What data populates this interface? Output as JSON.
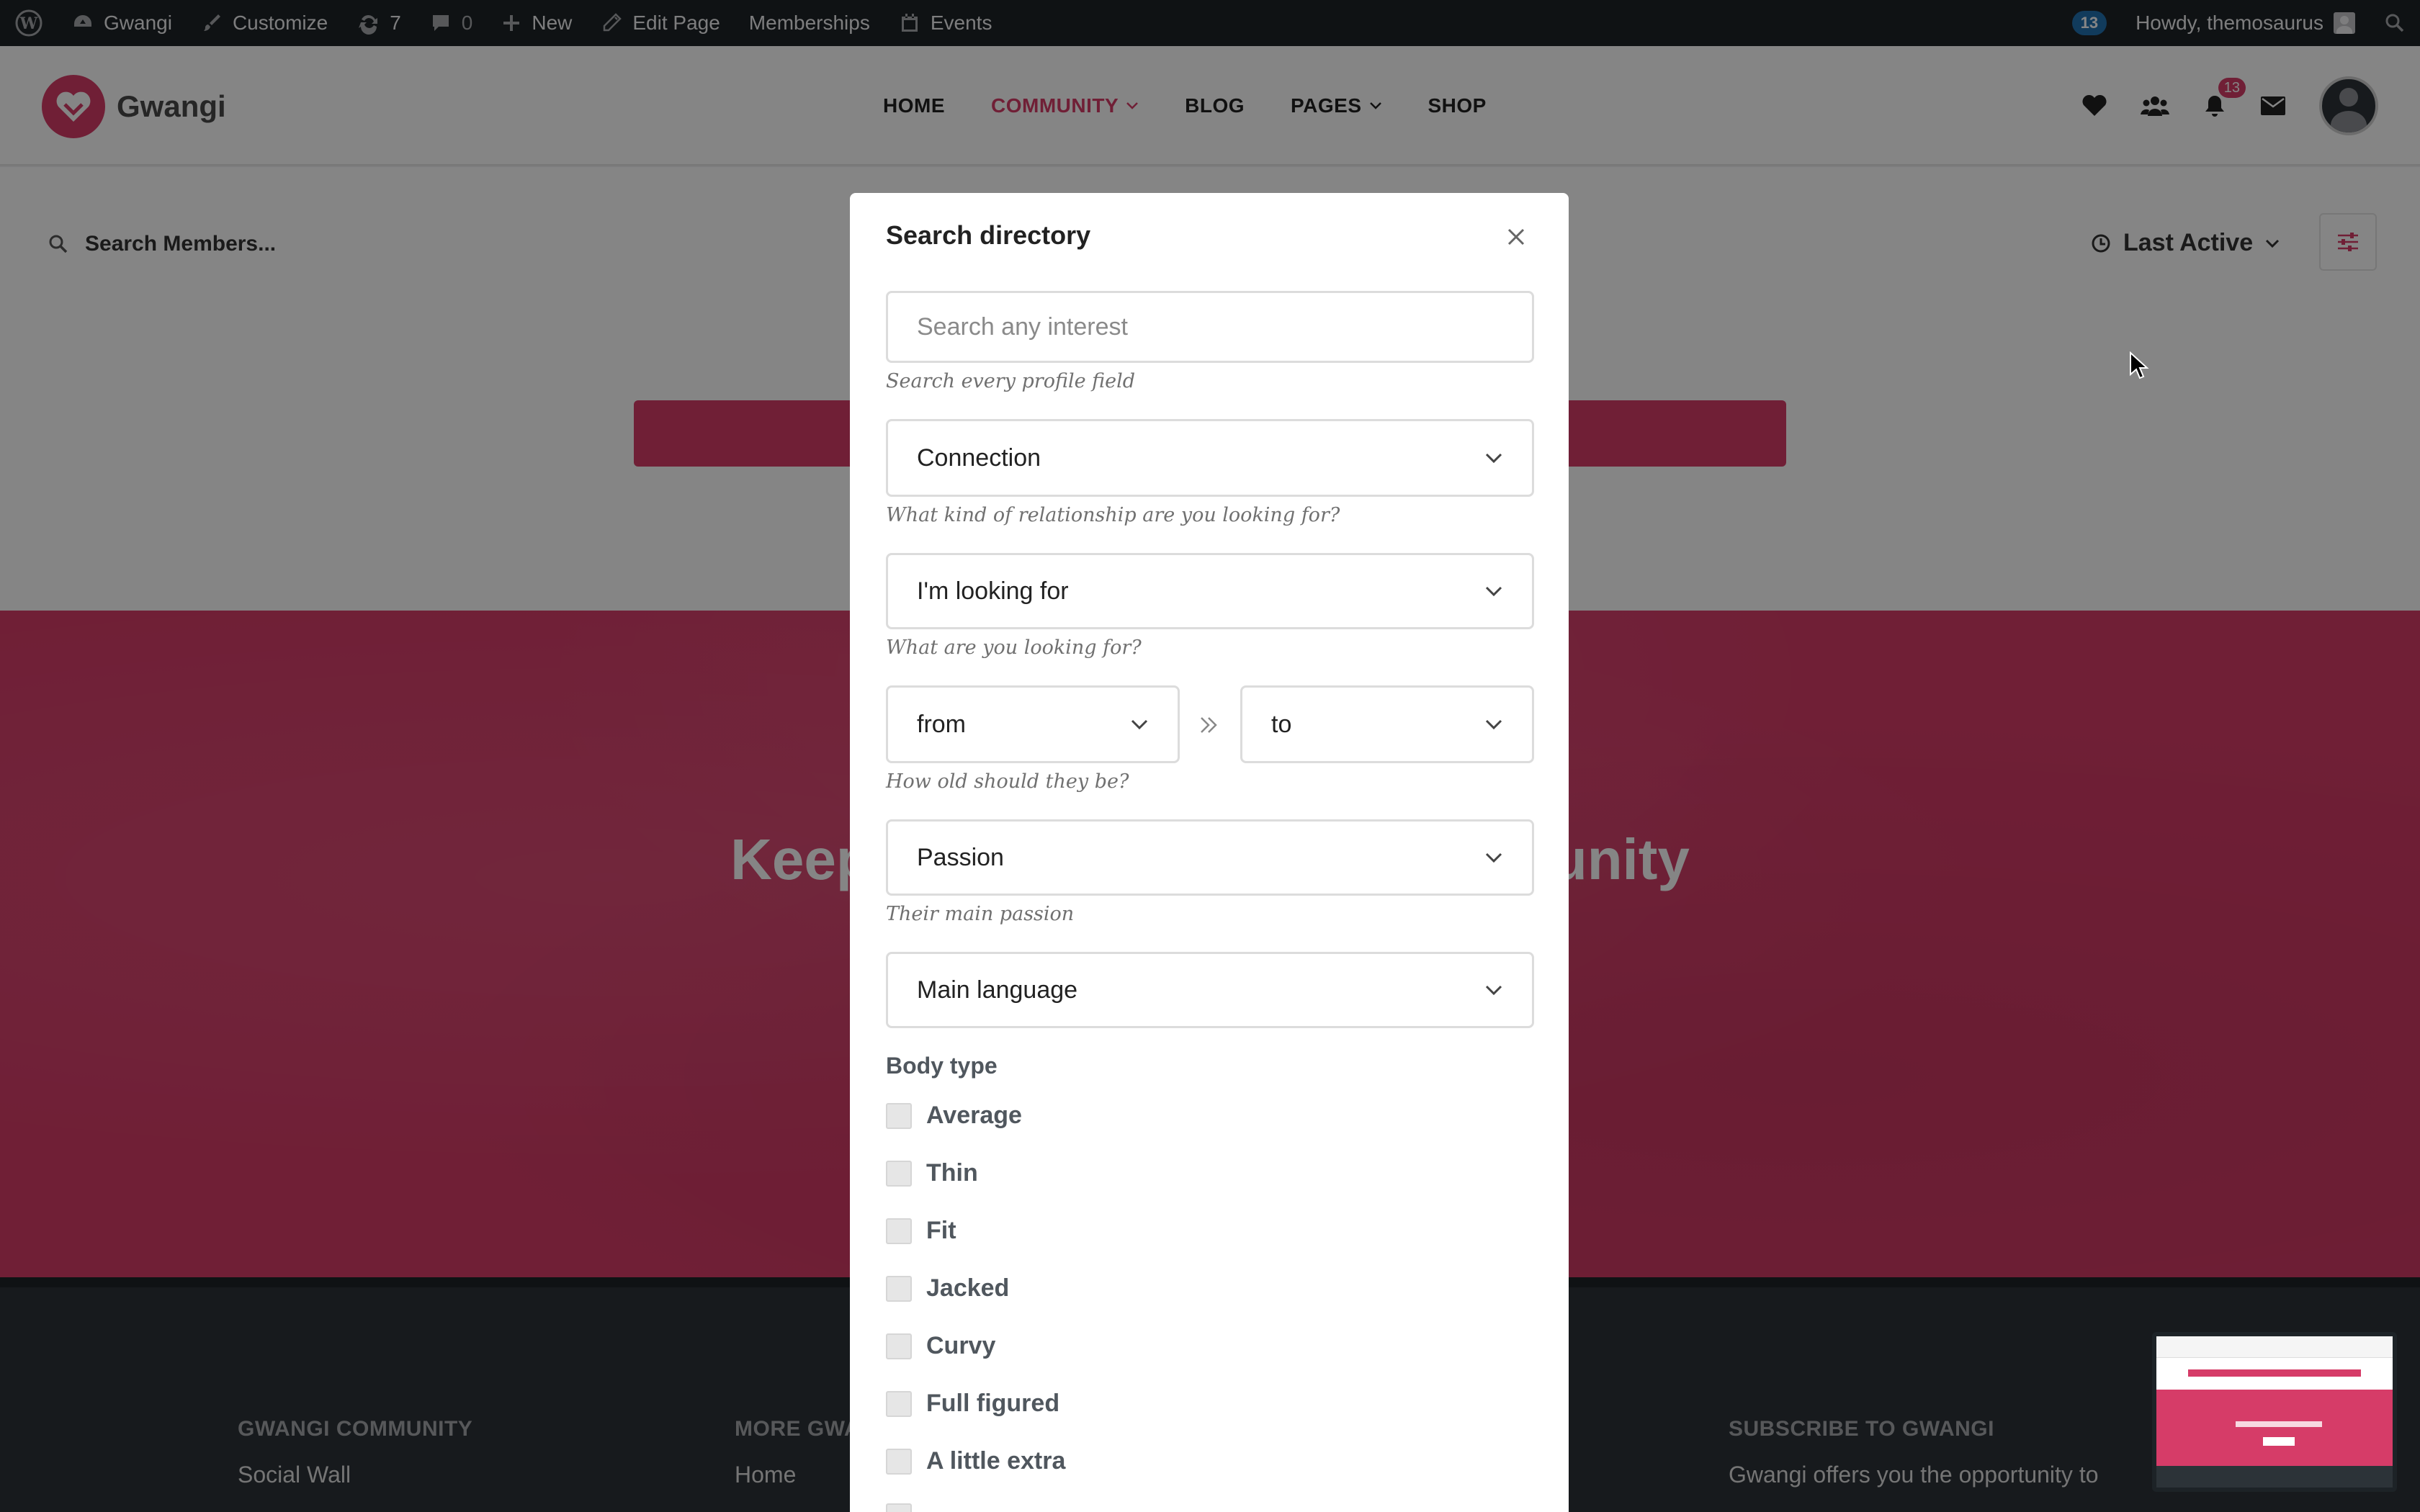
{
  "admin_bar": {
    "site_name": "Gwangi",
    "customize": "Customize",
    "updates_count": "7",
    "comments_count": "0",
    "new_label": "New",
    "edit_page": "Edit Page",
    "memberships": "Memberships",
    "events": "Events",
    "notifications_count": "13",
    "greeting": "Howdy, themosaurus"
  },
  "header": {
    "logo_text": "Gwangi",
    "nav": [
      {
        "label": "HOME"
      },
      {
        "label": "COMMUNITY"
      },
      {
        "label": "BLOG"
      },
      {
        "label": "PAGES"
      },
      {
        "label": "SHOP"
      }
    ],
    "messages_count": "13"
  },
  "members": {
    "search_placeholder": "Search Members...",
    "sort_label": "Last Active"
  },
  "hero": {
    "title": "Keep in Touch with the Community"
  },
  "modal": {
    "title": "Search directory",
    "interest_placeholder": "Search any interest",
    "interest_hint": "Search every profile field",
    "connection": "Connection",
    "connection_hint": "What kind of relationship are you looking for?",
    "looking_for": "I'm looking for",
    "looking_for_hint": "What are you looking for?",
    "age_from": "from",
    "age_to": "to",
    "age_hint": "How old should they be?",
    "passion": "Passion",
    "passion_hint": "Their main passion",
    "language": "Main language",
    "body_type_title": "Body type",
    "body_types": [
      "Average",
      "Thin",
      "Fit",
      "Jacked",
      "Curvy",
      "Full figured",
      "A little extra"
    ]
  },
  "footer": {
    "col1_title": "GWANGI COMMUNITY",
    "col1_link": "Social Wall",
    "col2_title": "MORE GWANGI",
    "col2_link": "Home",
    "col3_title": "SUBSCRIBE TO GWANGI",
    "col3_text": "Gwangi offers you the opportunity to"
  },
  "colors": {
    "brand_pink": "#d63c68",
    "admin_bar": "#1d2327",
    "footer": "#2c3338"
  }
}
